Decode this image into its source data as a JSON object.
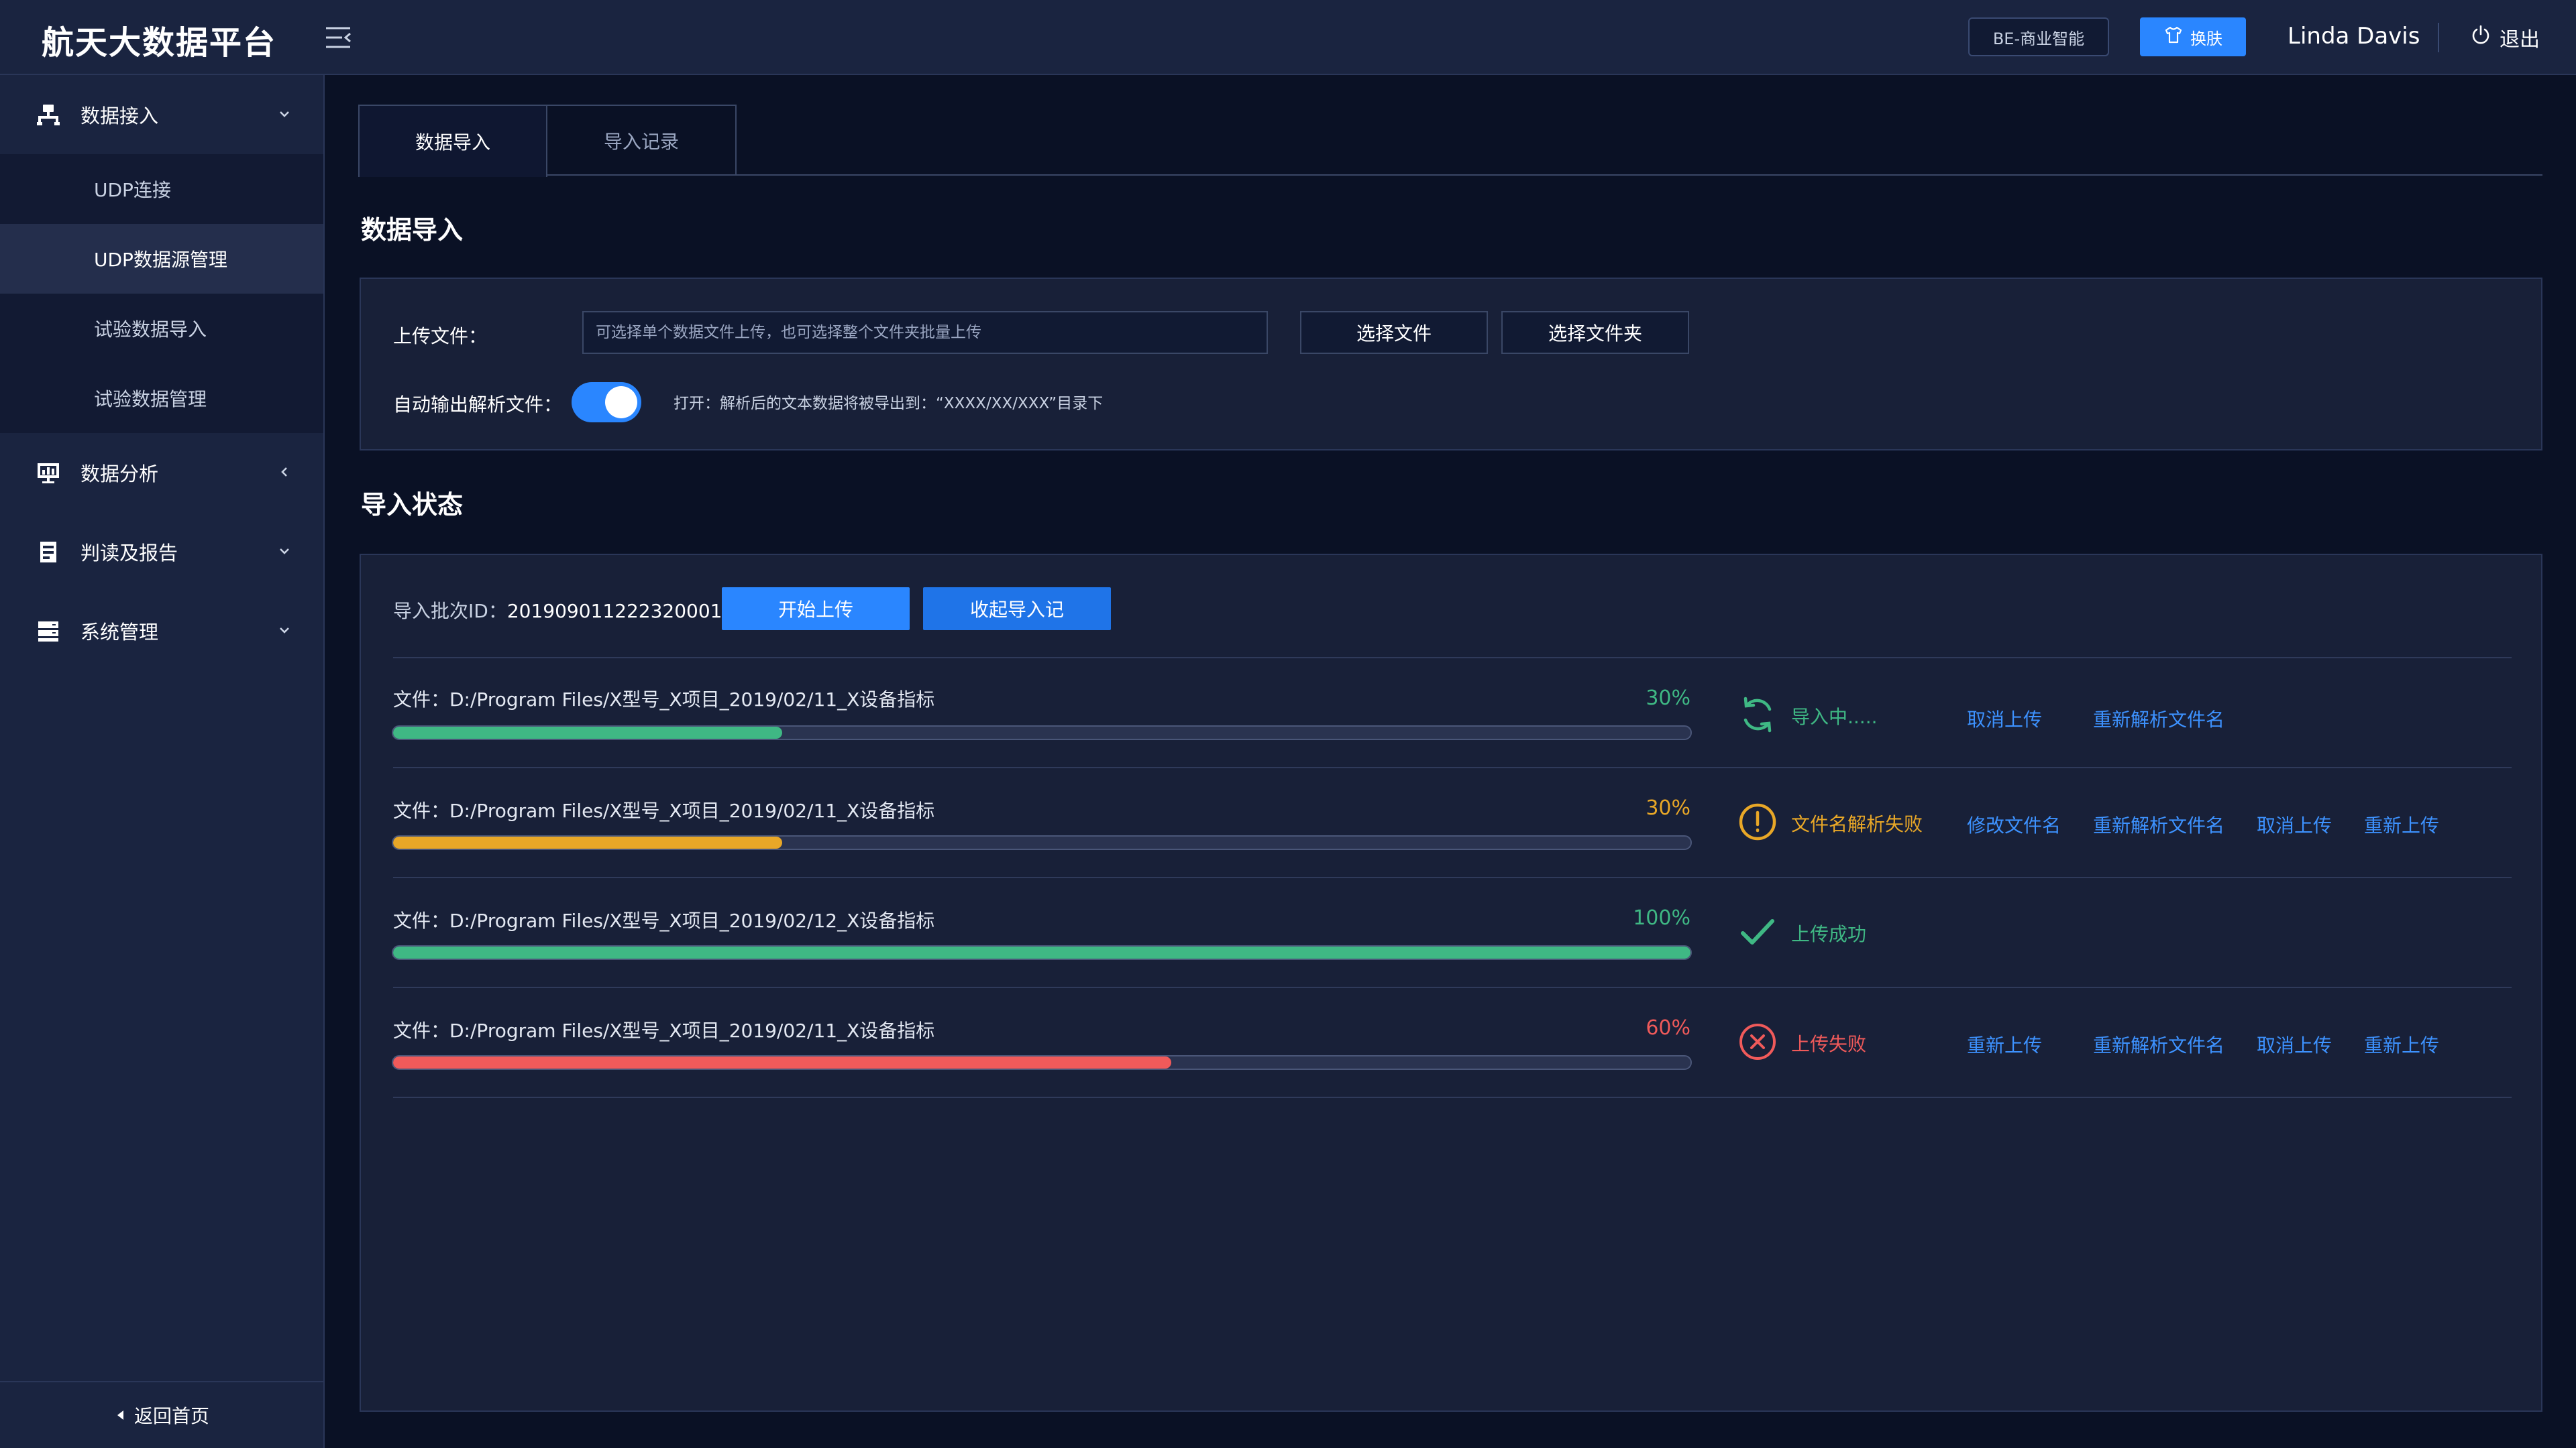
{
  "header": {
    "brand": "航天大数据平台",
    "be_button": "BE-商业智能",
    "skin_button": "换肤",
    "username": "Linda Davis",
    "logout": "退出"
  },
  "sidebar": {
    "groups": [
      {
        "label": "数据接入",
        "icon": "network-icon",
        "chevron": "chevron-down-icon",
        "items": [
          "UDP连接",
          "UDP数据源管理",
          "试验数据导入",
          "试验数据管理"
        ],
        "active_item": "UDP数据源管理"
      },
      {
        "label": "数据分析",
        "icon": "chart-monitor-icon",
        "chevron": "chevron-left-icon"
      },
      {
        "label": "判读及报告",
        "icon": "report-icon",
        "chevron": "chevron-down-icon"
      },
      {
        "label": "系统管理",
        "icon": "server-icon",
        "chevron": "chevron-down-icon"
      }
    ],
    "back_home": "返回首页"
  },
  "tabs": [
    {
      "label": "数据导入",
      "active": true
    },
    {
      "label": "导入记录",
      "active": false
    }
  ],
  "import_section": {
    "title": "数据导入",
    "upload_label": "上传文件：",
    "upload_placeholder": "可选择单个数据文件上传，也可选择整个文件夹批量上传",
    "choose_file": "选择文件",
    "choose_folder": "选择文件夹",
    "auto_output_label": "自动输出解析文件：",
    "auto_output_on": true,
    "auto_output_hint": "打开：解析后的文本数据将被导出到：“XXXX/XX/XXX”目录下"
  },
  "status_section": {
    "title": "导入状态",
    "batch_label": "导入批次ID：",
    "batch_id": "201909011222320001",
    "start_upload": "开始上传",
    "collapse_records": "收起导入记",
    "files": [
      {
        "name": "文件：D:/Program Files/X型号_X项目_2019/02/11_X设备指标",
        "progress": 30,
        "progress_text": "30%",
        "color": "#3fb884",
        "status": "导入中.....",
        "status_icon": "refresh-icon",
        "actions": [
          "取消上传",
          "重新解析文件名"
        ]
      },
      {
        "name": "文件：D:/Program Files/X型号_X项目_2019/02/11_X设备指标",
        "progress": 30,
        "progress_text": "30%",
        "color": "#e8a727",
        "status": "文件名解析失败",
        "status_icon": "warning-circle-icon",
        "actions": [
          "修改文件名",
          "重新解析文件名",
          "取消上传",
          "重新上传"
        ]
      },
      {
        "name": "文件：D:/Program Files/X型号_X项目_2019/02/12_X设备指标",
        "progress": 100,
        "progress_text": "100%",
        "color": "#3fb884",
        "status": "上传成功",
        "status_icon": "check-icon",
        "actions": []
      },
      {
        "name": "文件：D:/Program Files/X型号_X项目_2019/02/11_X设备指标",
        "progress": 60,
        "progress_text": "60%",
        "color": "#f05a5a",
        "status": "上传失败",
        "status_icon": "close-circle-icon",
        "actions": [
          "重新上传",
          "重新解析文件名",
          "取消上传",
          "重新上传"
        ]
      }
    ]
  }
}
